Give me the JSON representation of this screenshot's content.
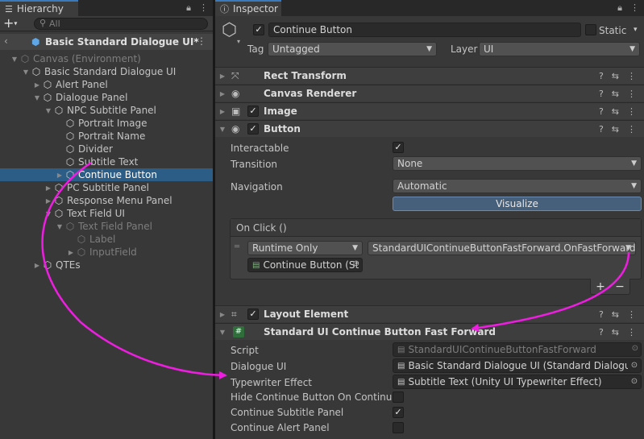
{
  "hierarchy": {
    "tab": "Hierarchy",
    "search_placeholder": "All",
    "add_label": "+",
    "scene": "Basic Standard Dialogue UI*",
    "items": [
      {
        "label": "Canvas (Environment)",
        "dim": true
      },
      {
        "label": "Basic Standard Dialogue UI"
      },
      {
        "label": "Alert Panel"
      },
      {
        "label": "Dialogue Panel"
      },
      {
        "label": "NPC Subtitle Panel"
      },
      {
        "label": "Portrait Image"
      },
      {
        "label": "Portrait Name"
      },
      {
        "label": "Divider"
      },
      {
        "label": "Subtitle Text"
      },
      {
        "label": "Continue Button",
        "selected": true
      },
      {
        "label": "PC Subtitle Panel"
      },
      {
        "label": "Response Menu Panel"
      },
      {
        "label": "Text Field UI"
      },
      {
        "label": "Text Field Panel",
        "dim": true
      },
      {
        "label": "Label",
        "dim": true
      },
      {
        "label": "InputField",
        "dim": true
      },
      {
        "label": "QTEs"
      }
    ]
  },
  "inspector": {
    "tab": "Inspector",
    "object_name": "Continue Button",
    "static_label": "Static",
    "tag_label": "Tag",
    "tag_value": "Untagged",
    "layer_label": "Layer",
    "layer_value": "UI",
    "components": {
      "rect": "Rect Transform",
      "canvas": "Canvas Renderer",
      "image": "Image",
      "button": "Button",
      "layout": "Layout Element",
      "sucb": "Standard UI Continue Button Fast Forward"
    },
    "button": {
      "interactable_label": "Interactable",
      "transition_label": "Transition",
      "transition_value": "None",
      "navigation_label": "Navigation",
      "navigation_value": "Automatic",
      "visualize_label": "Visualize"
    },
    "onclick": {
      "header": "On Click ()",
      "runtime": "Runtime Only",
      "function": "StandardUIContinueButtonFastForward.OnFastForward",
      "target": "Continue Button (St",
      "plus": "+",
      "minus": "−"
    },
    "script_fields": {
      "script_label": "Script",
      "script_value": "StandardUIContinueButtonFastForward",
      "dialogue_label": "Dialogue UI",
      "dialogue_value": "Basic Standard Dialogue UI (Standard Dialogue U",
      "typewriter_label": "Typewriter Effect",
      "typewriter_value": "Subtitle Text (Unity UI Typewriter Effect)",
      "hide_label": "Hide Continue Button On Continue",
      "subtitle_label": "Continue Subtitle Panel",
      "alert_label": "Continue Alert Panel"
    }
  },
  "colors": {
    "accent": "#3a79bb",
    "selection": "#2c5d87",
    "annotation": "#ee1ee0"
  }
}
